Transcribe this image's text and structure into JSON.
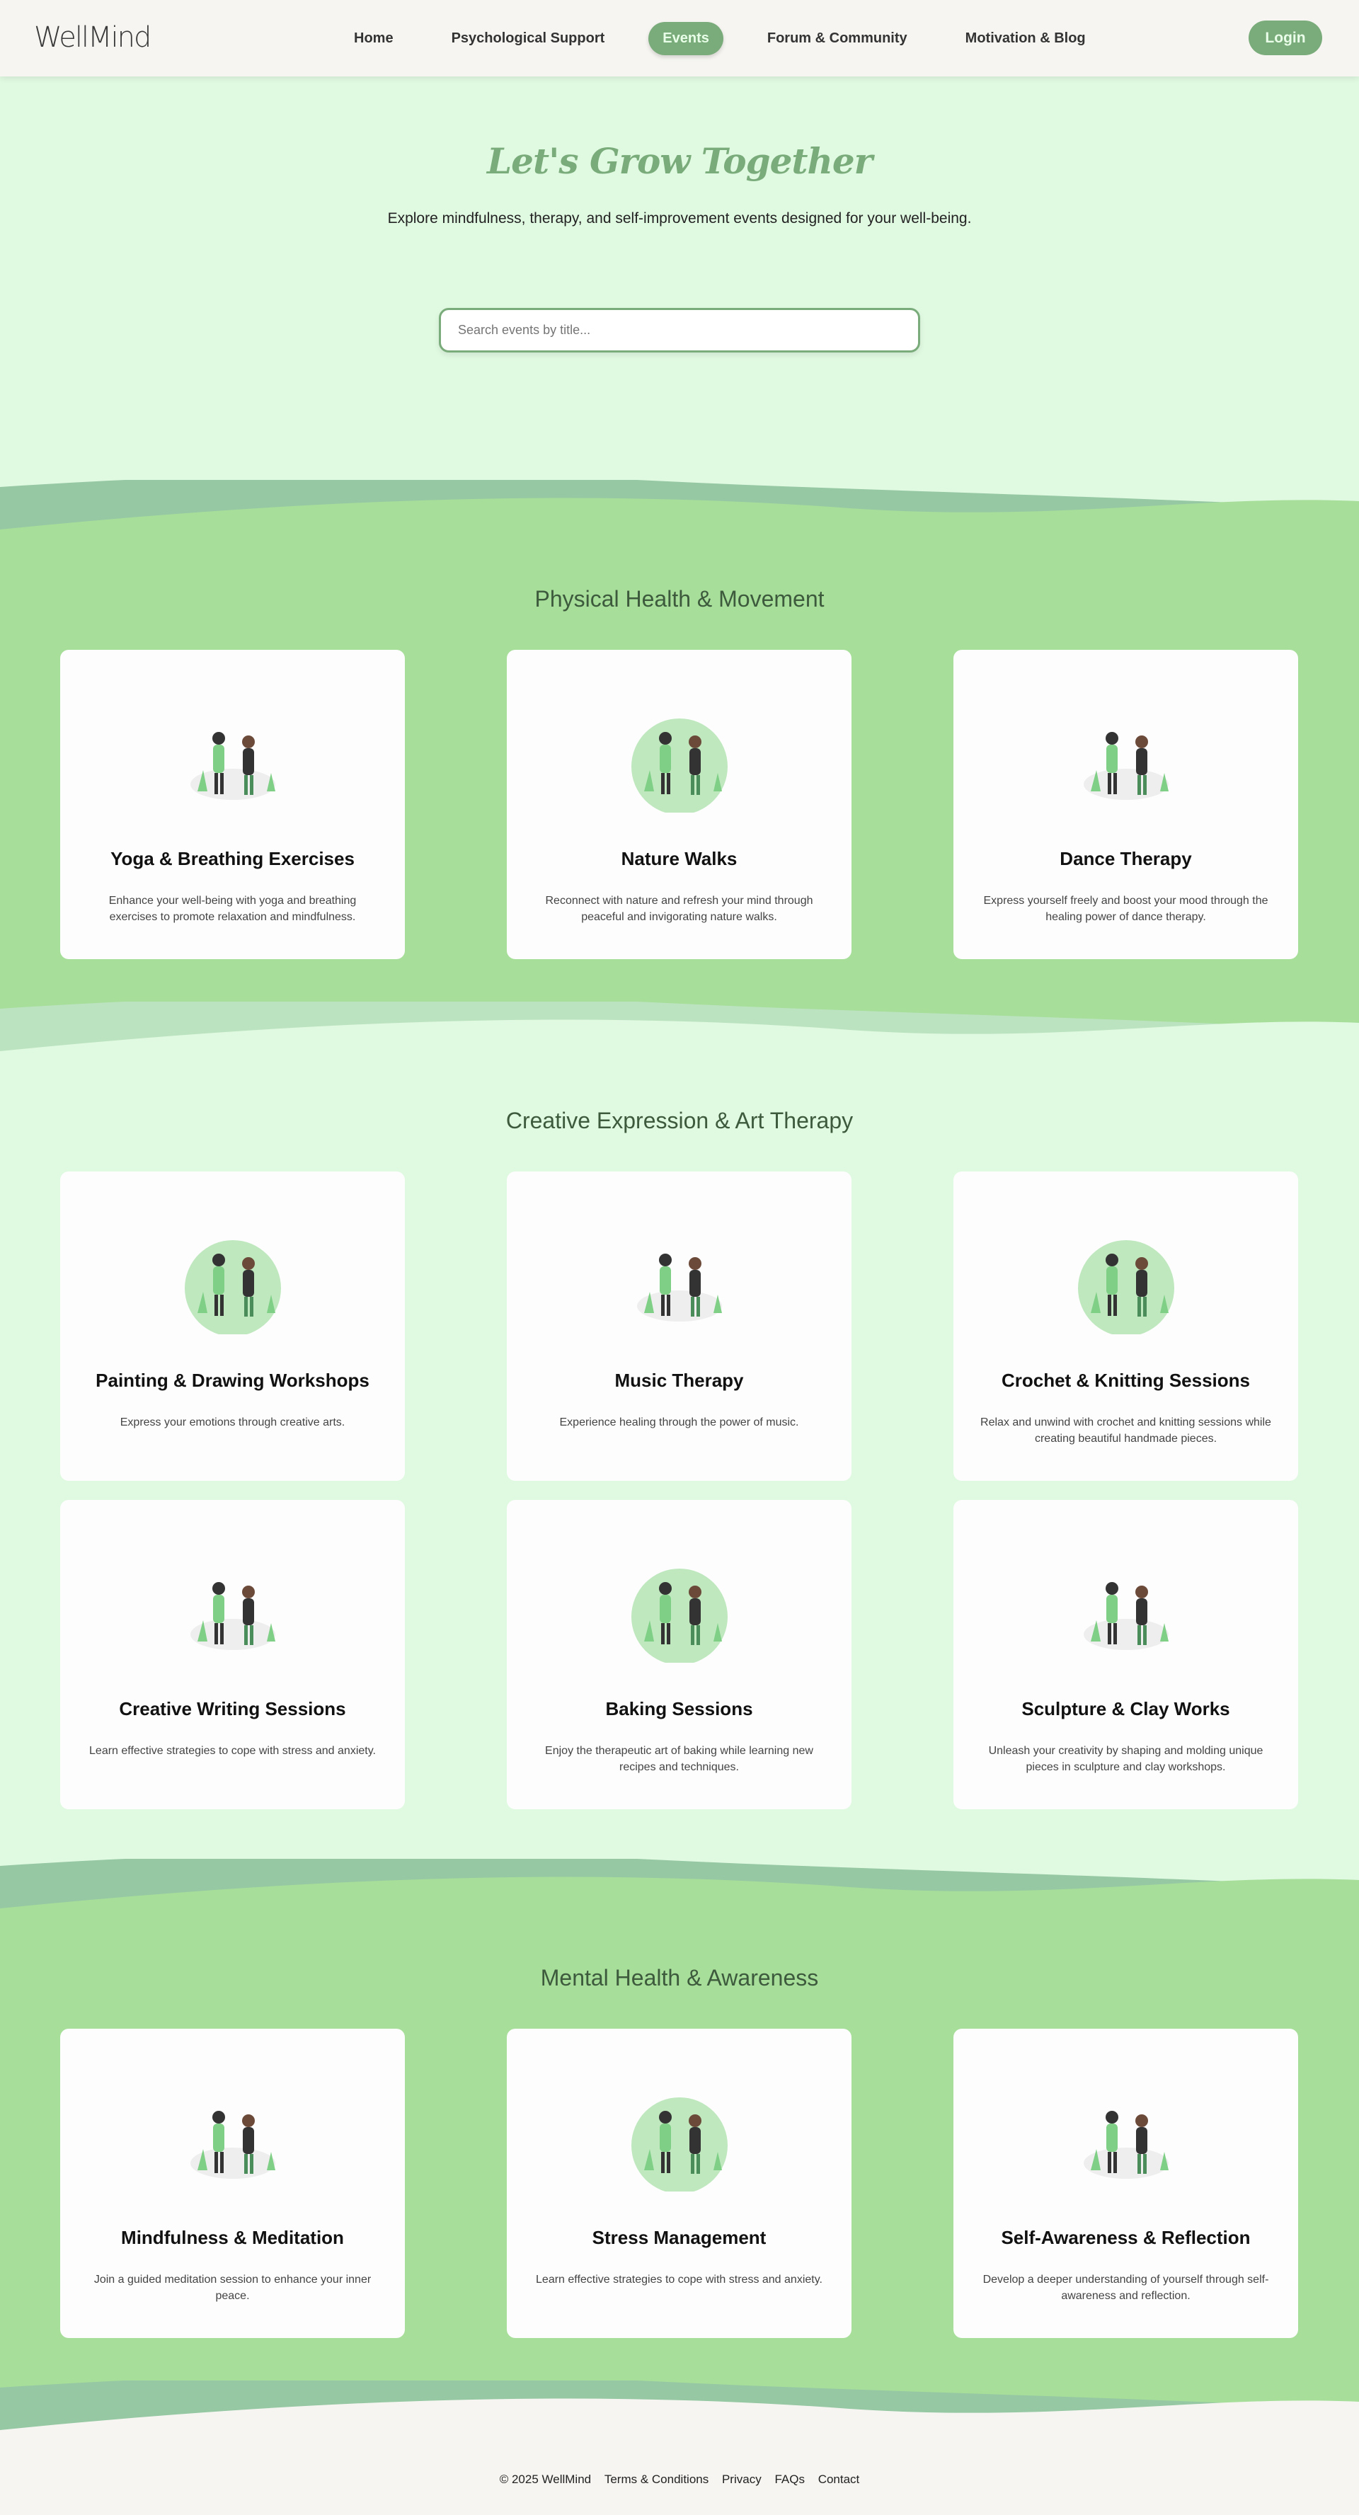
{
  "nav": {
    "logo": "WellMind",
    "links": [
      "Home",
      "Psychological Support",
      "Events",
      "Forum & Community",
      "Motivation & Blog"
    ],
    "active": "Events",
    "login": "Login"
  },
  "hero": {
    "title": "Let's Grow Together",
    "subtitle": "Explore mindfulness, therapy, and self-improvement events designed for your well-being.",
    "search_placeholder": "Search events by title..."
  },
  "sections": [
    {
      "title": "Physical Health & Movement",
      "cards": [
        {
          "title": "Yoga & Breathing Exercises",
          "desc": "Enhance your well-being with yoga and breathing exercises to promote relaxation and mindfulness."
        },
        {
          "title": "Nature Walks",
          "desc": "Reconnect with nature and refresh your mind through peaceful and invigorating nature walks."
        },
        {
          "title": "Dance Therapy",
          "desc": "Express yourself freely and boost your mood through the healing power of dance therapy."
        }
      ]
    },
    {
      "title": "Creative Expression & Art Therapy",
      "cards": [
        {
          "title": "Painting & Drawing Workshops",
          "desc": "Express your emotions through creative arts."
        },
        {
          "title": "Music Therapy",
          "desc": "Experience healing through the power of music."
        },
        {
          "title": "Crochet & Knitting Sessions",
          "desc": "Relax and unwind with crochet and knitting sessions while creating beautiful handmade pieces."
        },
        {
          "title": "Creative Writing Sessions",
          "desc": "Learn effective strategies to cope with stress and anxiety."
        },
        {
          "title": "Baking Sessions",
          "desc": "Enjoy the therapeutic art of baking while learning new recipes and techniques."
        },
        {
          "title": "Sculpture & Clay Works",
          "desc": "Unleash your creativity by shaping and molding unique pieces in sculpture and clay workshops."
        }
      ]
    },
    {
      "title": "Mental Health & Awareness",
      "cards": [
        {
          "title": "Mindfulness & Meditation",
          "desc": "Join a guided meditation session to enhance your inner peace."
        },
        {
          "title": "Stress Management",
          "desc": "Learn effective strategies to cope with stress and anxiety."
        },
        {
          "title": "Self-Awareness & Reflection",
          "desc": "Develop a deeper understanding of yourself through self-awareness and reflection."
        }
      ]
    }
  ],
  "footer": {
    "copyright": "© 2025 WellMind",
    "links": [
      "Terms & Conditions",
      "Privacy",
      "FAQs",
      "Contact"
    ]
  },
  "colors": {
    "accent": "#7aab7a",
    "green_bg": "#a6de9a",
    "light_bg": "#e0f9e1",
    "footer_bg": "#f6f5f1"
  }
}
